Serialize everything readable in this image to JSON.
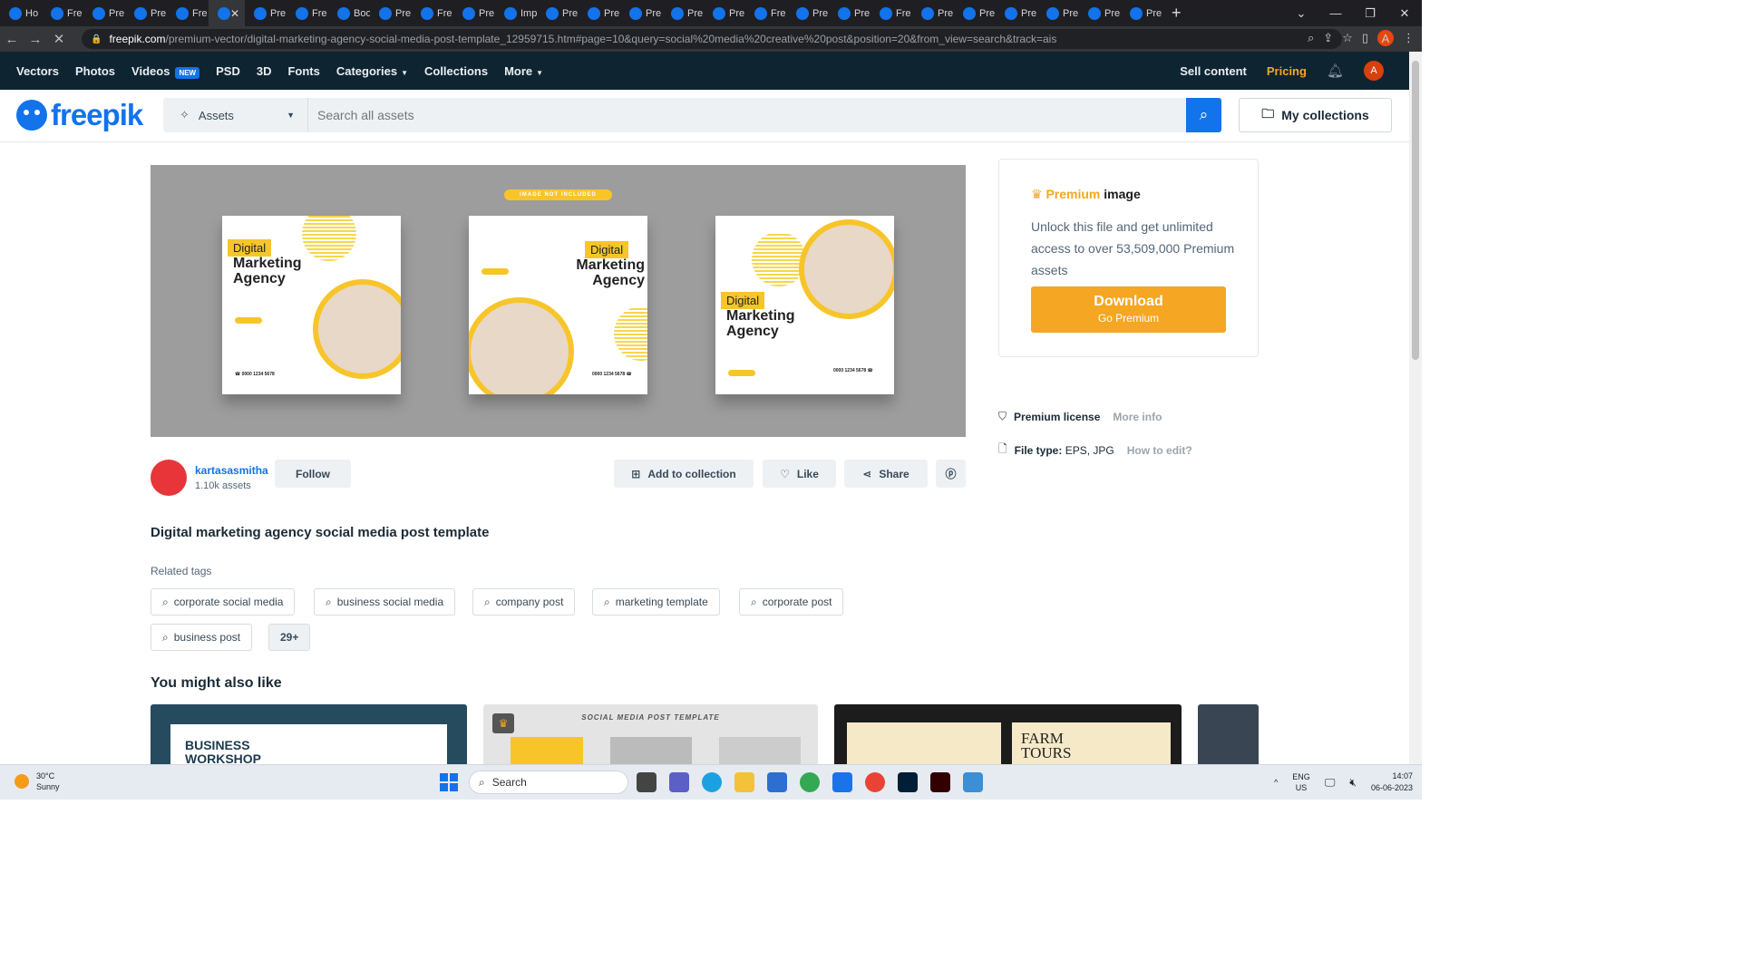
{
  "browser": {
    "tabs": [
      "Ho",
      "Fre",
      "Pre",
      "Pre",
      "Fre",
      "",
      "Pre",
      "Fre",
      "Boo",
      "Pre",
      "Fre",
      "Pre",
      "Imp",
      "Pre",
      "Pre",
      "Pre",
      "Pre",
      "Pre",
      "Fre",
      "Pre",
      "Pre",
      "Fre",
      "Pre",
      "Pre",
      "Pre",
      "Pre",
      "Pre",
      "Pre"
    ],
    "url_host": "freepik.com",
    "url_path": "/premium-vector/digital-marketing-agency-social-media-post-template_12959715.htm#page=10&query=social%20media%20creative%20post&position=20&from_view=search&track=ais",
    "profile_initial": "A"
  },
  "topnav": {
    "items": [
      "Vectors",
      "Photos",
      "Videos",
      "PSD",
      "3D",
      "Fonts",
      "Categories",
      "Collections",
      "More"
    ],
    "new_badge": "NEW",
    "sell": "Sell content",
    "pricing": "Pricing",
    "user_initial": "A"
  },
  "header": {
    "logo": "freepik",
    "assets_label": "Assets",
    "search_placeholder": "Search all assets",
    "my_collections": "My collections"
  },
  "preview": {
    "note": "IMAGE NOT INCLUDED",
    "cards": [
      {
        "t1": "Digital",
        "t2": "Marketing Agency"
      },
      {
        "t1": "Digital",
        "t2": "Marketing Agency"
      },
      {
        "t1": "Digital",
        "t2": "Marketing Agency"
      }
    ]
  },
  "author": {
    "name": "kartasasmitha",
    "count": "1.10k assets",
    "follow": "Follow"
  },
  "actions": {
    "add": "Add to collection",
    "like": "Like",
    "share": "Share"
  },
  "title": "Digital marketing agency social media post template",
  "related_label": "Related tags",
  "tags": [
    "corporate social media",
    "business social media",
    "company post",
    "marketing template",
    "corporate post",
    "business post"
  ],
  "more_tags": "29+",
  "ymal": "You might also like",
  "thumbs": {
    "t1": "BUSINESS WORKSHOP",
    "t2": "SOCIAL MEDIA POST TEMPLATE",
    "t3": "FARM TOURS"
  },
  "side": {
    "premium": "Premium",
    "image": " image",
    "desc": "Unlock this file and get unlimited access to over 53,509,000 Premium assets",
    "download": "Download",
    "go_premium": "Go Premium",
    "license": "Premium license",
    "more_info": "More info",
    "filetype_label": "File type:",
    "filetype": "EPS, JPG",
    "how_edit": "How to edit?"
  },
  "taskbar": {
    "temp": "30°C",
    "cond": "Sunny",
    "search": "Search",
    "lang1": "ENG",
    "lang2": "US",
    "time": "14:07",
    "date": "06-06-2023"
  }
}
